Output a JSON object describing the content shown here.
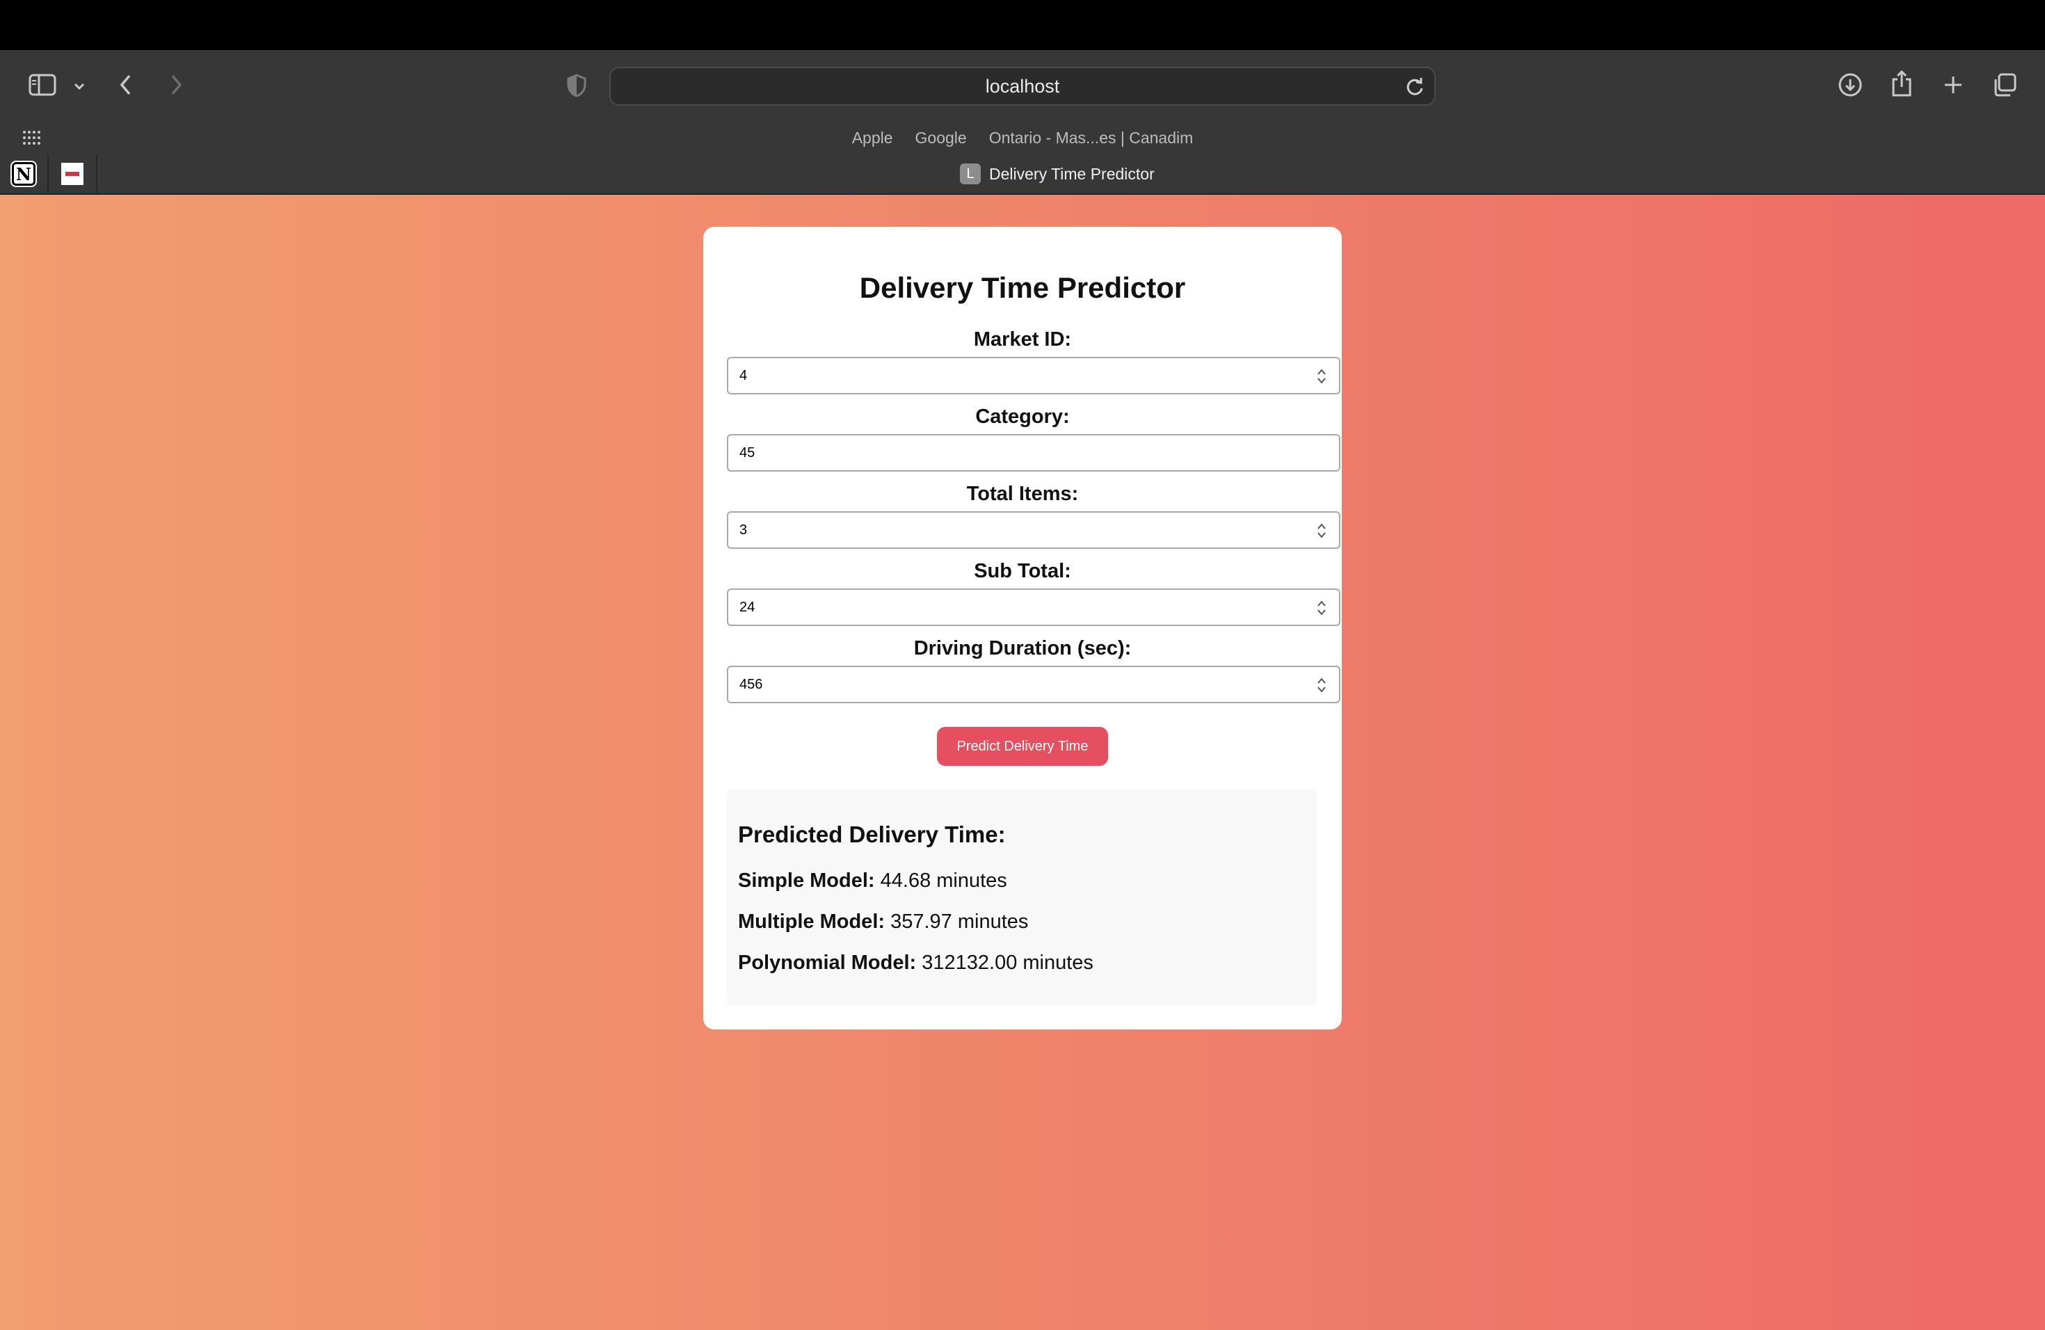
{
  "browser": {
    "url": "localhost",
    "favorites": [
      "Apple",
      "Google",
      "Ontario - Mas...es | Canadim"
    ],
    "active_tab": {
      "favicon_letter": "L",
      "title": "Delivery Time Predictor"
    }
  },
  "form": {
    "title": "Delivery Time Predictor",
    "fields": [
      {
        "label": "Market ID:",
        "value": "4",
        "type": "number"
      },
      {
        "label": "Category:",
        "value": "45",
        "type": "text"
      },
      {
        "label": "Total Items:",
        "value": "3",
        "type": "number"
      },
      {
        "label": "Sub Total:",
        "value": "24",
        "type": "number"
      },
      {
        "label": "Driving Duration (sec):",
        "value": "456",
        "type": "number"
      }
    ],
    "submit_label": "Predict Delivery Time"
  },
  "results": {
    "title": "Predicted Delivery Time:",
    "items": [
      {
        "label": "Simple Model:",
        "value": "44.68 minutes"
      },
      {
        "label": "Multiple Model:",
        "value": "357.97 minutes"
      },
      {
        "label": "Polynomial Model:",
        "value": "312132.00 minutes"
      }
    ]
  }
}
